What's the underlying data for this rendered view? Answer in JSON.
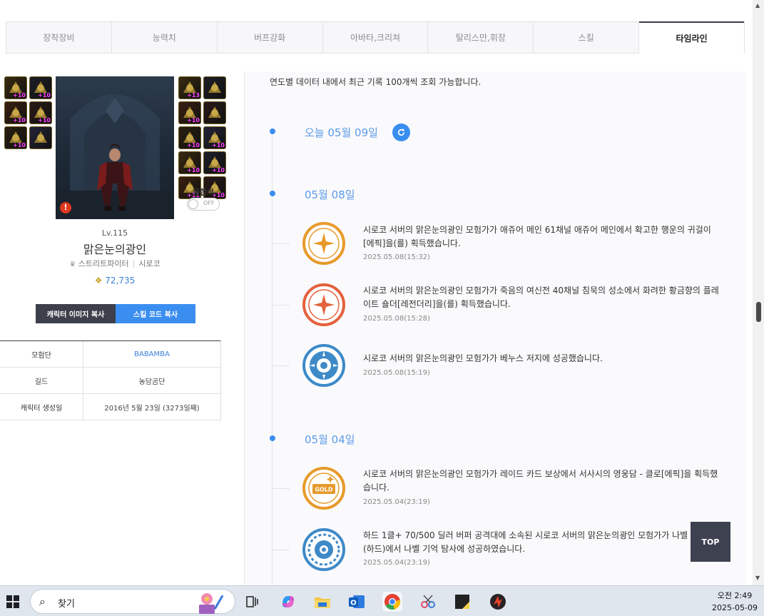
{
  "tabs": [
    {
      "label": "장착장비"
    },
    {
      "label": "능력치"
    },
    {
      "label": "버프강화"
    },
    {
      "label": "아바타,크리쳐"
    },
    {
      "label": "탈리스만,휘장"
    },
    {
      "label": "스킬"
    },
    {
      "label": "타임라인"
    }
  ],
  "equipment": {
    "left_slots": [
      "+10",
      "+10",
      "+10",
      "+10",
      "+10",
      ""
    ],
    "right_slots": [
      "+13",
      "",
      "+10",
      "",
      "+10",
      "+10",
      "+10",
      "+10",
      "+11",
      "+10"
    ]
  },
  "character": {
    "fusion_label": "융합석",
    "toggle_label": "OFF",
    "warning": "!",
    "level": "Lv.115",
    "name": "맑은눈의광인",
    "job": "스트리트파이터",
    "server": "시로코",
    "fame": "72,735"
  },
  "buttons": {
    "copy_image": "캐릭터 이미지 복사",
    "copy_skill": "스킬 코드 복사"
  },
  "info": [
    {
      "key": "모험단",
      "value": "BABAMBA"
    },
    {
      "key": "길드",
      "value": "농담곰단"
    },
    {
      "key": "캐릭터 생성일",
      "value": "2016년 5월 23일 (3273일째)"
    }
  ],
  "timeline": {
    "notice": "연도별 데이터 내에서 최근 기록 100개씩 조회 가능합니다.",
    "today": "오늘 05월 09일",
    "dates": [
      "05월 08일",
      "05월 04일"
    ],
    "events": [
      {
        "text": "시로코 서버의 맑은눈의광인 모험가가 애쥬어 메인 61채널 애쥬어 메인에서 확고한 행운의 귀걸이[에픽]을(를) 획득했습니다.",
        "time": "2025.05.08(15:32)",
        "color": "#e79a2b"
      },
      {
        "text": "시로코 서버의 맑은눈의광인 모험가가 죽음의 여신전 40채널 침묵의 성소에서 화려한 황금향의 플레이트 숄더[레전더리]을(를) 획득했습니다.",
        "time": "2025.05.08(15:28)",
        "color": "#e4623d"
      },
      {
        "text": "시로코 서버의 맑은눈의광인 모험가가 베누스 저지에 성공했습니다.",
        "time": "2025.05.08(15:19)",
        "color": "#3e8ac8"
      },
      {
        "text": "시로코 서버의 맑은눈의광인 모험가가 레이드 카드 보상에서 서사시의 영웅담 - 클로[에픽]을 획득했습니다.",
        "time": "2025.05.04(23:19)",
        "color": "#e79a2b",
        "badge": "GOLD"
      },
      {
        "text": "하드 1클+ 70/500 딜러 버퍼 공격대에 소속된 시로코 서버의 맑은눈의광인 모험가가 나벨 지의 악(하드)에서 나벨 기억 탐사에 성공하였습니다.",
        "time": "2025.05.04(23:19)",
        "color": "#3e8ac8"
      }
    ]
  },
  "top_button": "TOP",
  "taskbar": {
    "search": "찾기",
    "time": "오전 2:49",
    "date": "2025-05-09"
  }
}
